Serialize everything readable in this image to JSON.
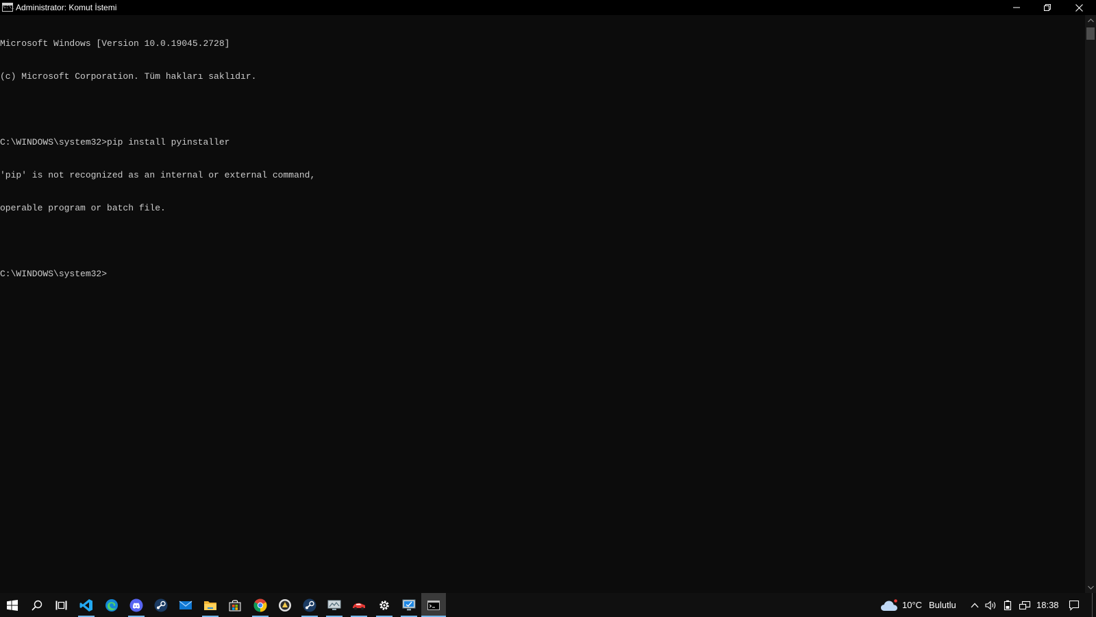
{
  "window": {
    "title": "Administrator: Komut İstemi",
    "icon": "cmd-icon",
    "icon_text": "C:\\_"
  },
  "console": {
    "lines": [
      "Microsoft Windows [Version 10.0.19045.2728]",
      "(c) Microsoft Corporation. Tüm hakları saklıdır.",
      "",
      "C:\\WINDOWS\\system32>pip install pyinstaller",
      "'pip' is not recognized as an internal or external command,",
      "operable program or batch file.",
      "",
      "C:\\WINDOWS\\system32>"
    ],
    "text_color": "#cccccc",
    "background": "#0c0c0c"
  },
  "taskbar": {
    "apps": [
      {
        "icon": "windows-start-icon",
        "running": false
      },
      {
        "icon": "search-icon",
        "running": false
      },
      {
        "icon": "task-view-icon",
        "running": false
      },
      {
        "icon": "vscode-icon",
        "running": true
      },
      {
        "icon": "edge-icon",
        "running": false
      },
      {
        "icon": "discord-icon",
        "running": true
      },
      {
        "icon": "steam-icon",
        "running": false
      },
      {
        "icon": "mail-icon",
        "running": false
      },
      {
        "icon": "file-explorer-icon",
        "running": true
      },
      {
        "icon": "store-icon",
        "running": false
      },
      {
        "icon": "chrome-icon",
        "running": true
      },
      {
        "icon": "game-launcher-icon",
        "running": false
      },
      {
        "icon": "steam-icon",
        "running": true
      },
      {
        "icon": "network-monitor-icon",
        "running": true
      },
      {
        "icon": "racing-game-icon",
        "running": true
      },
      {
        "icon": "settings-gear-icon",
        "running": true
      },
      {
        "icon": "remote-desktop-icon",
        "running": true
      },
      {
        "icon": "cmd-icon",
        "running": true,
        "active": true
      }
    ],
    "weather": {
      "temperature": "10°C",
      "condition": "Bulutlu",
      "icon": "cloud-icon"
    },
    "tray": [
      "chevron-up-icon",
      "volume-icon",
      "battery-icon",
      "network-icon"
    ],
    "clock": "18:38",
    "accent": "#76b9ed"
  }
}
